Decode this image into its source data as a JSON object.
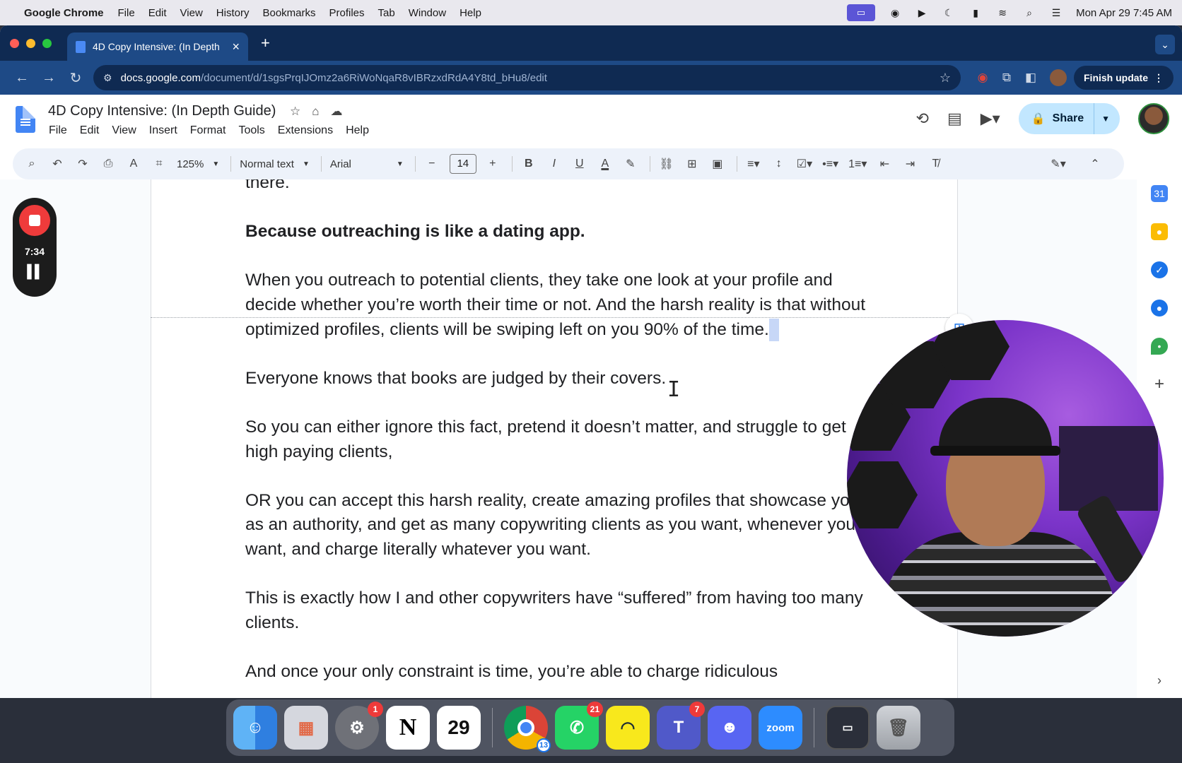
{
  "menubar": {
    "app_name": "Google Chrome",
    "items": [
      "File",
      "Edit",
      "View",
      "History",
      "Bookmarks",
      "Profiles",
      "Tab",
      "Window",
      "Help"
    ],
    "datetime": "Mon Apr 29  7:45 AM"
  },
  "browser": {
    "tab_title": "4D Copy Intensive: (In Depth",
    "url_host": "docs.google.com",
    "url_path": "/document/d/1sgsPrqIJOmz2a6RiWoNqaR8vIBRzxdRdA4Y8td_bHu8/edit",
    "finish_update_label": "Finish update"
  },
  "docs": {
    "title": "4D Copy Intensive: (In Depth Guide)",
    "menus": [
      "File",
      "Edit",
      "View",
      "Insert",
      "Format",
      "Tools",
      "Extensions",
      "Help"
    ],
    "share_label": "Share",
    "toolbar": {
      "zoom": "125%",
      "style": "Normal text",
      "font": "Arial",
      "font_size": "14"
    }
  },
  "document": {
    "paragraphs": [
      {
        "text": "there.",
        "bold": false
      },
      {
        "text": "Because outreaching is like a dating app.",
        "bold": true
      },
      {
        "text": "When you outreach to potential clients, they take one look at your profile and decide whether you’re worth their time or not. And the harsh reality is that without optimized profiles, clients will be swiping left on you 90% of the time.",
        "bold": false
      },
      {
        "text": "Everyone knows that books are judged by their covers.",
        "bold": false
      },
      {
        "text": "So you can either ignore this fact, pretend it doesn’t matter, and struggle to get high paying clients,",
        "bold": false
      },
      {
        "text": "OR you can accept this harsh reality, create amazing profiles that showcase you as an authority, and get as many copywriting clients as you want, whenever you want, and charge literally whatever you want.",
        "bold": false
      },
      {
        "text": "This is exactly how I and other copywriters have “suffered” from having too many clients.",
        "bold": false
      },
      {
        "text": "And once your only constraint is time, you’re able to charge ridiculous",
        "bold": false
      }
    ]
  },
  "recorder": {
    "time": "7:34"
  },
  "dock": {
    "apps": [
      {
        "name": "Finder",
        "label": "",
        "badge": ""
      },
      {
        "name": "Launchpad",
        "label": "",
        "badge": ""
      },
      {
        "name": "System Settings",
        "label": "",
        "badge": "1"
      },
      {
        "name": "Notion",
        "label": "N",
        "badge": ""
      },
      {
        "name": "Calendar",
        "label": "29",
        "badge": ""
      },
      {
        "name": "Chrome",
        "label": "",
        "badge": "13"
      },
      {
        "name": "WhatsApp",
        "label": "",
        "badge": "21"
      },
      {
        "name": "Basecamp",
        "label": "",
        "badge": ""
      },
      {
        "name": "Teams",
        "label": "T",
        "badge": "7"
      },
      {
        "name": "Discord",
        "label": "",
        "badge": ""
      },
      {
        "name": "Zoom",
        "label": "zoom",
        "badge": ""
      },
      {
        "name": "Screenshot",
        "label": "",
        "badge": ""
      },
      {
        "name": "Trash",
        "label": "",
        "badge": ""
      }
    ]
  },
  "colors": {
    "tab_strip": "#0f2a52",
    "toolbar": "#1e4a86",
    "share_button": "#c2e7ff",
    "accent_blue": "#1a73e8",
    "record_red": "#ef3b3b"
  }
}
